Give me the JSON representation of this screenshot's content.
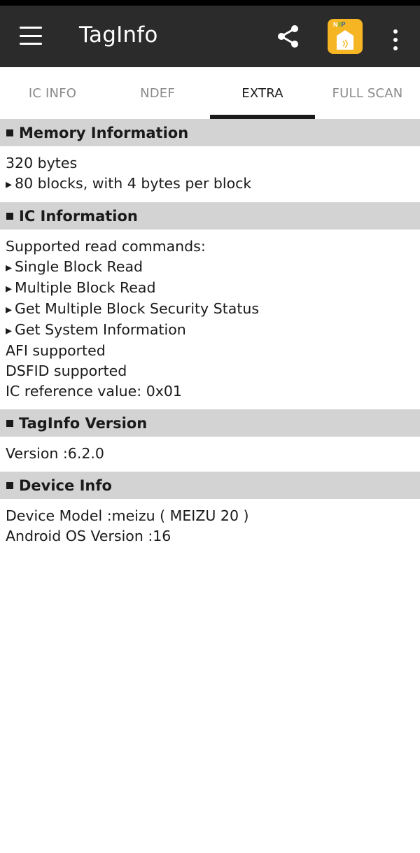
{
  "app": {
    "title": "TagInfo",
    "icons": {
      "menu": "hamburger-menu-icon",
      "share": "share-icon",
      "nxp": "nxp-app-icon",
      "overflow": "more-vert-icon"
    },
    "colors": {
      "app_bar": "#2b2b2b",
      "accent": "#f6b523",
      "section_header": "#d3d3d3"
    }
  },
  "tabs": [
    {
      "label": "IC INFO",
      "active": false
    },
    {
      "label": "NDEF",
      "active": false
    },
    {
      "label": "EXTRA",
      "active": true
    },
    {
      "label": "FULL SCAN",
      "active": false
    }
  ],
  "sections": {
    "memory": {
      "title": "Memory Information",
      "lines": [
        "320 bytes",
        "80 blocks, with 4 bytes per block"
      ]
    },
    "ic": {
      "title": "IC Information",
      "lines": [
        "Supported read commands:",
        "Single Block Read",
        "Multiple Block Read",
        "Get Multiple Block Security Status",
        "Get System Information",
        "AFI supported",
        "DSFID supported",
        "IC reference value: 0x01"
      ]
    },
    "version": {
      "title": "TagInfo Version",
      "lines": [
        "Version :6.2.0"
      ]
    },
    "device": {
      "title": "Device Info",
      "lines": [
        "Device Model :meizu ( MEIZU 20 )",
        "Android OS Version :16"
      ]
    }
  }
}
